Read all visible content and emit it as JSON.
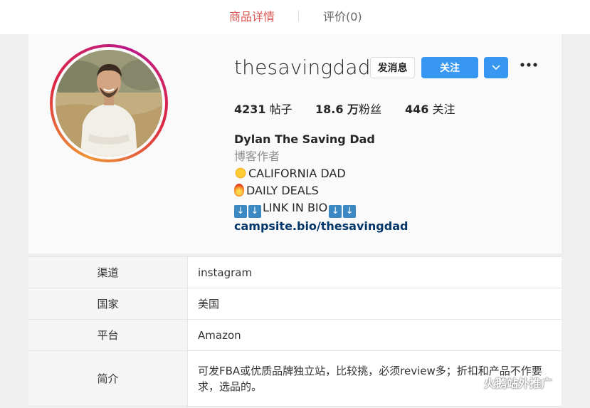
{
  "tabs": [
    {
      "label": "商品详情",
      "active": true
    },
    {
      "label": "评价(0)",
      "active": false
    }
  ],
  "profile": {
    "username": "thesavingdad",
    "message_button": "发消息",
    "follow_button": "关注",
    "stats": {
      "posts_value": "4231",
      "posts_label": " 帖子",
      "followers_value": "18.6 万",
      "followers_label": "粉丝",
      "following_value": "446",
      "following_label": " 关注"
    },
    "bio": {
      "name": "Dylan The Saving Dad",
      "category": "博客作者",
      "line1": "CALIFORNIA DAD",
      "line2": "DAILY DEALS",
      "line3": "LINK IN BIO",
      "link": "campsite.bio/thesavingdad"
    }
  },
  "info_table": {
    "rows": [
      {
        "label": "渠道",
        "value": "instagram"
      },
      {
        "label": "国家",
        "value": "美国"
      },
      {
        "label": "平台",
        "value": "Amazon"
      },
      {
        "label": "简介",
        "value": "可发FBA或优质品牌独立站，比较挑，必须review多；折扣和产品不作要求，选品的。"
      }
    ]
  },
  "watermark": "火鹅站外推广",
  "colors": {
    "accent": "#3897f0",
    "tab_active": "#d9534f",
    "link": "#003569"
  }
}
